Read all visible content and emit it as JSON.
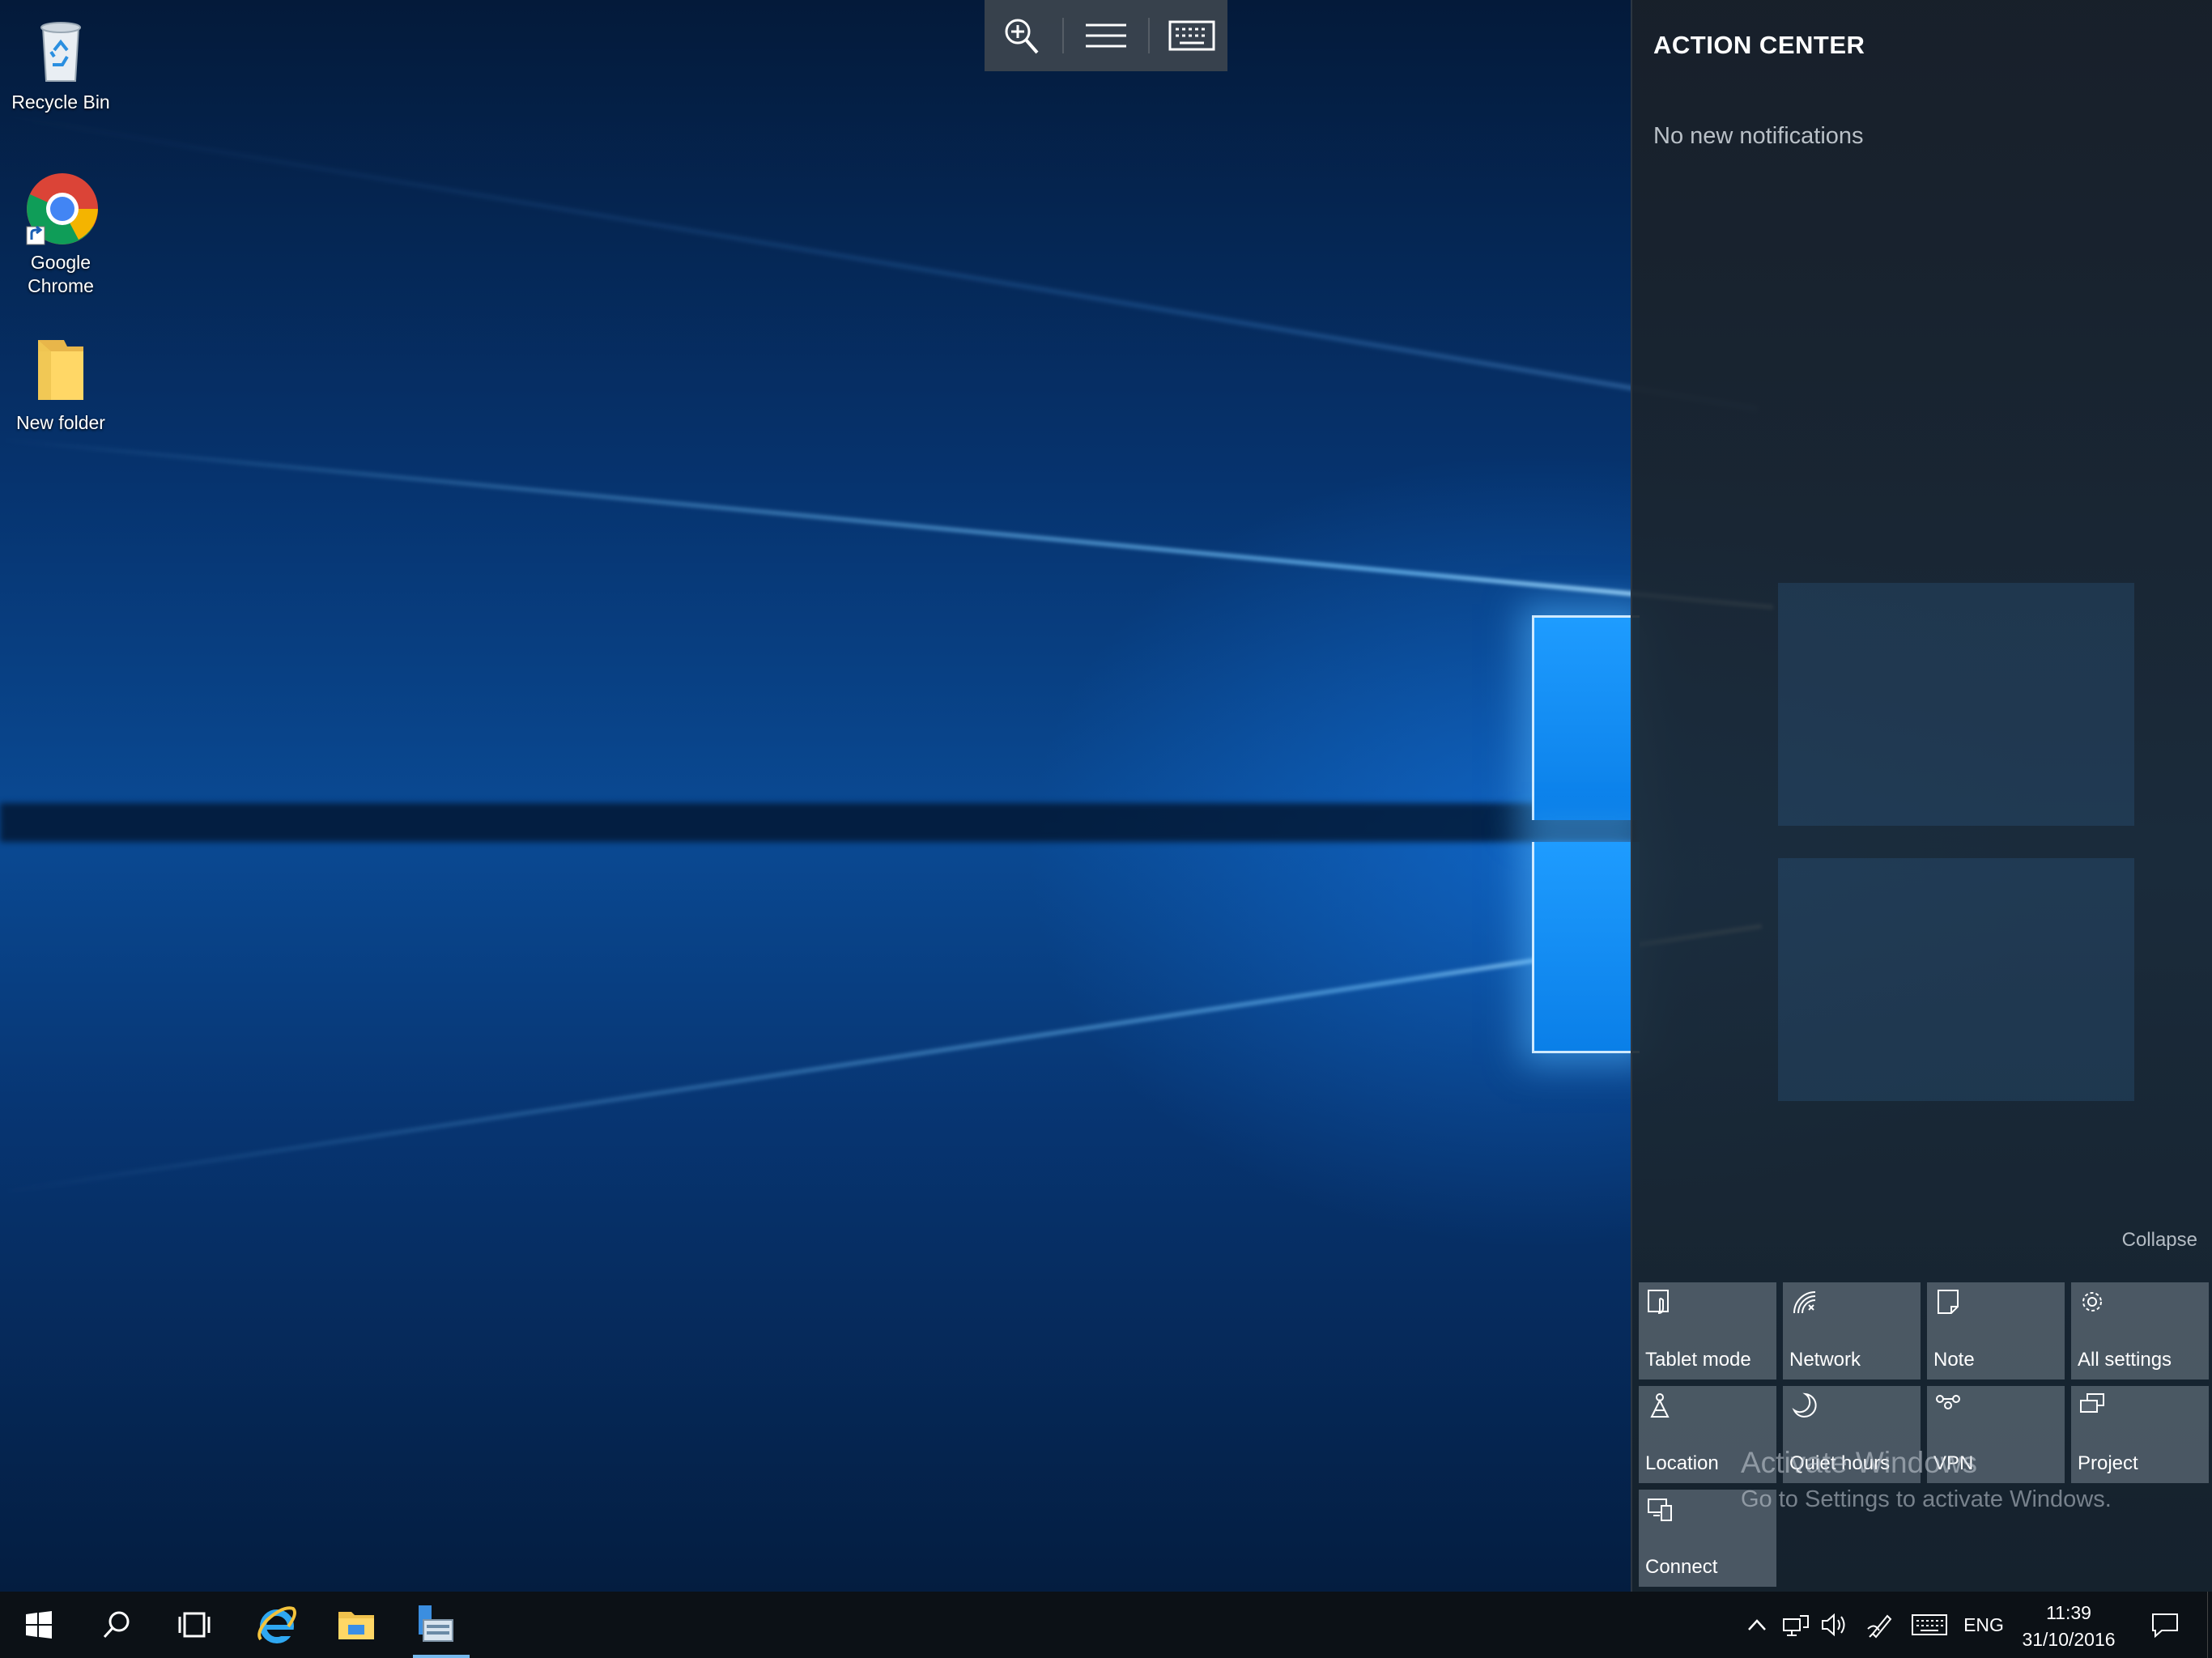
{
  "desktop": {
    "icons": [
      {
        "label": "Recycle Bin",
        "icon": "recycle-bin-icon"
      },
      {
        "label": "Google\nChrome",
        "icon": "chrome-icon"
      },
      {
        "label": "New folder",
        "icon": "folder-icon"
      }
    ]
  },
  "touch_toolbar": {
    "buttons": [
      "zoom-in-icon",
      "menu-icon",
      "keyboard-icon"
    ]
  },
  "action_center": {
    "title": "ACTION CENTER",
    "empty_message": "No new notifications",
    "collapse_label": "Collapse",
    "tiles": [
      {
        "label": "Tablet mode",
        "icon": "tablet-mode-icon"
      },
      {
        "label": "Network",
        "icon": "network-icon"
      },
      {
        "label": "Note",
        "icon": "note-icon"
      },
      {
        "label": "All settings",
        "icon": "gear-icon"
      },
      {
        "label": "Location",
        "icon": "location-icon"
      },
      {
        "label": "Quiet hours",
        "icon": "moon-icon"
      },
      {
        "label": "VPN",
        "icon": "vpn-icon"
      },
      {
        "label": "Project",
        "icon": "project-icon"
      },
      {
        "label": "Connect",
        "icon": "connect-icon"
      }
    ]
  },
  "watermark": {
    "line1": "Activate Windows",
    "line2": "Go to Settings to activate Windows."
  },
  "taskbar": {
    "pinned": [
      "start-icon",
      "search-icon",
      "task-view-icon",
      "internet-explorer-icon",
      "file-explorer-icon",
      "server-manager-icon"
    ],
    "tray_icons": [
      "chevron-up-icon",
      "network-tray-icon",
      "volume-icon",
      "pen-icon",
      "touch-keyboard-icon"
    ],
    "language": "ENG",
    "time": "11:39",
    "date": "31/10/2016",
    "notification_icon": "notification-icon"
  },
  "colors": {
    "accent": "#0a7fe8",
    "action_center_bg": "#18202a",
    "tile_bg": "#5a6672",
    "taskbar_bg": "#0c1116",
    "active_app_underline": "#76b9ed"
  }
}
